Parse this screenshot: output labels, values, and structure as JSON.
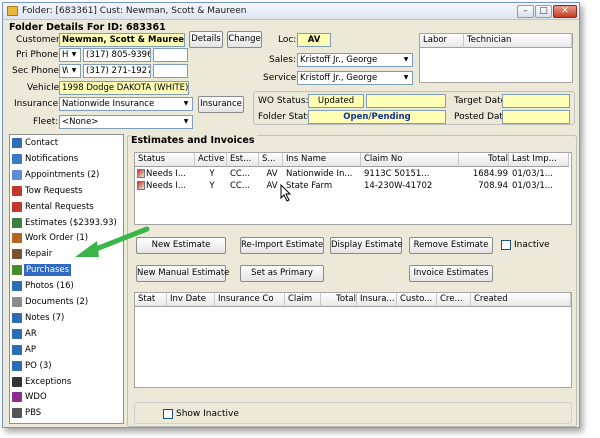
{
  "window": {
    "title": "Folder: [683361]  Cust: Newman, Scott & Maureen"
  },
  "header": {
    "folder_details": "Folder Details For ID:  683361",
    "customer_label": "Customer:",
    "customer_value": "Newman, Scott & Maureen",
    "details_btn": "Details",
    "change_btn": "Change",
    "pri_phone_label": "Pri Phone:",
    "pri_phone_type": "H",
    "pri_phone": "(317) 805-9396",
    "sec_phone_label": "Sec Phone:",
    "sec_phone_type": "W",
    "sec_phone": "(317) 271-1927",
    "vehicle_label": "Vehicle:",
    "vehicle_value": "1998 Dodge DAKOTA (WHITE)",
    "insurance_label": "Insurance:",
    "insurance_value": "Nationwide Insurance",
    "insurance_btn": "Insurance",
    "fleet_label": "Fleet:",
    "fleet_value": "<None>",
    "loc_label": "Loc:",
    "loc_value": "AV",
    "sales_label": "Sales:",
    "sales_value": "Kristoff Jr., George",
    "service_label": "Service:",
    "service_value": "Kristoff Jr., George",
    "labor_col": "Labor",
    "tech_col": "Technician",
    "wo_status_label": "WO Status:",
    "wo_status_value": "Updated",
    "folder_status_label": "Folder Status:",
    "folder_status_value": "Open/Pending",
    "target_date_label": "Target Date:",
    "posted_date_label": "Posted Date:"
  },
  "sidebar": {
    "items": [
      {
        "label": "Contact",
        "icon": "contact-icon",
        "color": "#2f6fb7"
      },
      {
        "label": "Notifications",
        "icon": "notifications-icon",
        "color": "#3a7bc8"
      },
      {
        "label": "Appointments (2)",
        "icon": "appointments-icon",
        "color": "#5b8ed6"
      },
      {
        "label": "Tow Requests",
        "icon": "tow-icon",
        "color": "#c0392b"
      },
      {
        "label": "Rental Requests",
        "icon": "rental-icon",
        "color": "#c0392b"
      },
      {
        "label": "Estimates ($2393.93)",
        "icon": "estimates-icon",
        "color": "#3d7f3d"
      },
      {
        "label": "Work Order (1)",
        "icon": "work-order-icon",
        "color": "#b5651d"
      },
      {
        "label": "Repair",
        "icon": "repair-icon",
        "color": "#7a5230"
      },
      {
        "label": "Purchases",
        "icon": "purchases-icon",
        "color": "#4a8b2e"
      },
      {
        "label": "Photos (16)",
        "icon": "photos-icon",
        "color": "#2a6db0"
      },
      {
        "label": "Documents (2)",
        "icon": "documents-icon",
        "color": "#8c8c8c"
      },
      {
        "label": "Notes (7)",
        "icon": "notes-icon",
        "color": "#2a6db0"
      },
      {
        "label": "AR",
        "icon": "ar-icon",
        "color": "#2a6db0"
      },
      {
        "label": "AP",
        "icon": "ap-icon",
        "color": "#2a6db0"
      },
      {
        "label": "PO (3)",
        "icon": "po-icon",
        "color": "#2a6db0"
      },
      {
        "label": "Exceptions",
        "icon": "exceptions-icon",
        "color": "#333333"
      },
      {
        "label": "WDO",
        "icon": "wdo-icon",
        "color": "#8e2d8e"
      },
      {
        "label": "PBS",
        "icon": "pbs-icon",
        "color": "#555555"
      }
    ],
    "selected": "Purchases"
  },
  "estimates": {
    "title": "Estimates and Invoices",
    "columns": [
      "Status",
      "Active",
      "Est...",
      "S...",
      "Ins Name",
      "Claim No",
      "Total",
      "Last Imp..."
    ],
    "rows": [
      [
        "Needs I...",
        "Y",
        "CC...",
        "AV",
        "Nationwide In...",
        "9113C 50151...",
        "1684.99",
        "01/03/1..."
      ],
      [
        "Needs I...",
        "Y",
        "CC...",
        "AV",
        "State Farm",
        "14-230W-41702",
        "708.94",
        "01/03/1..."
      ]
    ],
    "buttons": {
      "new_estimate": "New Estimate",
      "reimport": "Re-Import Estimate",
      "display": "Display Estimate",
      "remove": "Remove Estimate",
      "inactive": "Inactive",
      "new_manual": "New Manual Estimate",
      "set_primary": "Set as Primary",
      "invoice": "Invoice Estimates"
    }
  },
  "invoices": {
    "columns": [
      "Stat",
      "Inv Date",
      "Insurance Co",
      "Claim",
      "Total",
      "Insura...",
      "Custo...",
      "Cre...",
      "Created"
    ]
  },
  "show_inactive": "Show Inactive",
  "colors": {
    "selection": "#316ac5",
    "arrow": "#39b54a",
    "yellow_field": "#ffffb5"
  }
}
